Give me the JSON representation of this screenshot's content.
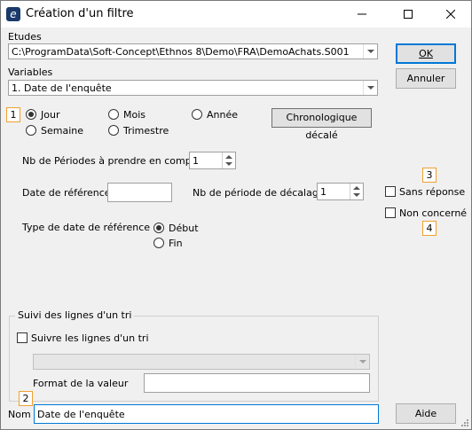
{
  "window": {
    "title": "Création d'un filtre",
    "app_icon_glyph": "e"
  },
  "etudes": {
    "label": "Etudes",
    "value": "C:\\ProgramData\\Soft-Concept\\Ethnos 8\\Demo\\FRA\\DemoAchats.S001"
  },
  "variables": {
    "label": "Variables",
    "value": "1. Date de l'enquête"
  },
  "buttons": {
    "ok": "OK",
    "annuler": "Annuler",
    "chronologique": "Chronologique décalé",
    "aide": "Aide"
  },
  "markers": {
    "m1": "1",
    "m2": "2",
    "m3": "3",
    "m4": "4"
  },
  "period_options": {
    "jour": "Jour",
    "mois": "Mois",
    "annee": "Année",
    "semaine": "Semaine",
    "trimestre": "Trimestre",
    "selected": "Jour"
  },
  "nb_periodes": {
    "label": "Nb de Périodes à prendre en compte",
    "value": "1"
  },
  "date_reference": {
    "label": "Date de référence",
    "value": ""
  },
  "nb_decalage": {
    "label": "Nb de période de décalage",
    "value": "1"
  },
  "type_date": {
    "label": "Type de date de référence",
    "debut": "Début",
    "fin": "Fin",
    "selected": "Début"
  },
  "checkboxes": {
    "sans_reponse": "Sans réponse",
    "non_concerne": "Non concerné"
  },
  "suivi": {
    "group_title": "Suivi des lignes d'un tri",
    "checkbox_label": "Suivre les lignes d'un tri",
    "combo_value": "",
    "format_label": "Format de la valeur",
    "format_value": ""
  },
  "nom": {
    "label": "Nom",
    "value": "Date de l'enquête"
  },
  "colors": {
    "accent": "#0078d7",
    "marker_border": "#f0a030"
  }
}
